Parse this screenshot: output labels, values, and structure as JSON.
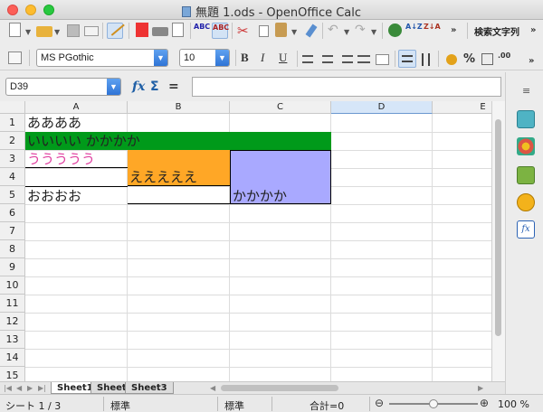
{
  "window": {
    "title": "無題 1.ods - OpenOffice Calc"
  },
  "toolbar": {
    "find_text_label": "検索文字列",
    "font_name": "MS PGothic",
    "font_size": "10",
    "bold_label": "B",
    "italic_label": "I",
    "underline_label": "U",
    "percent_label": "%"
  },
  "formula_bar": {
    "cell_reference": "D39",
    "function_wizard_label": "fx",
    "sum_label": "Σ",
    "equals_label": "=",
    "formula_value": ""
  },
  "sheet": {
    "columns": [
      "A",
      "B",
      "C",
      "D",
      "E"
    ],
    "rows": [
      "1",
      "2",
      "3",
      "4",
      "5",
      "6",
      "7",
      "8",
      "9",
      "10",
      "11",
      "12",
      "13",
      "14",
      "15"
    ],
    "cells": {
      "A1": "ああああ",
      "A2": "いいいい かかかか",
      "A3": "ううううう",
      "A5": "おおおお",
      "B4": "えええええ",
      "C5": "かかかか"
    },
    "colors": {
      "A2_fill": "#009a1a",
      "A3_text": "#e040a0",
      "B4_fill": "#ffa726",
      "C_merged_fill": "#a9a9ff",
      "header_selected": "#d6e6f8"
    }
  },
  "tabs": [
    "Sheet1",
    "Sheet2",
    "Sheet3"
  ],
  "active_tab": "Sheet1",
  "status": {
    "sheet_position": "シート 1 / 3",
    "page_style": "標準",
    "mode": "標準",
    "sum": "合計=0",
    "zoom": "100 %"
  }
}
